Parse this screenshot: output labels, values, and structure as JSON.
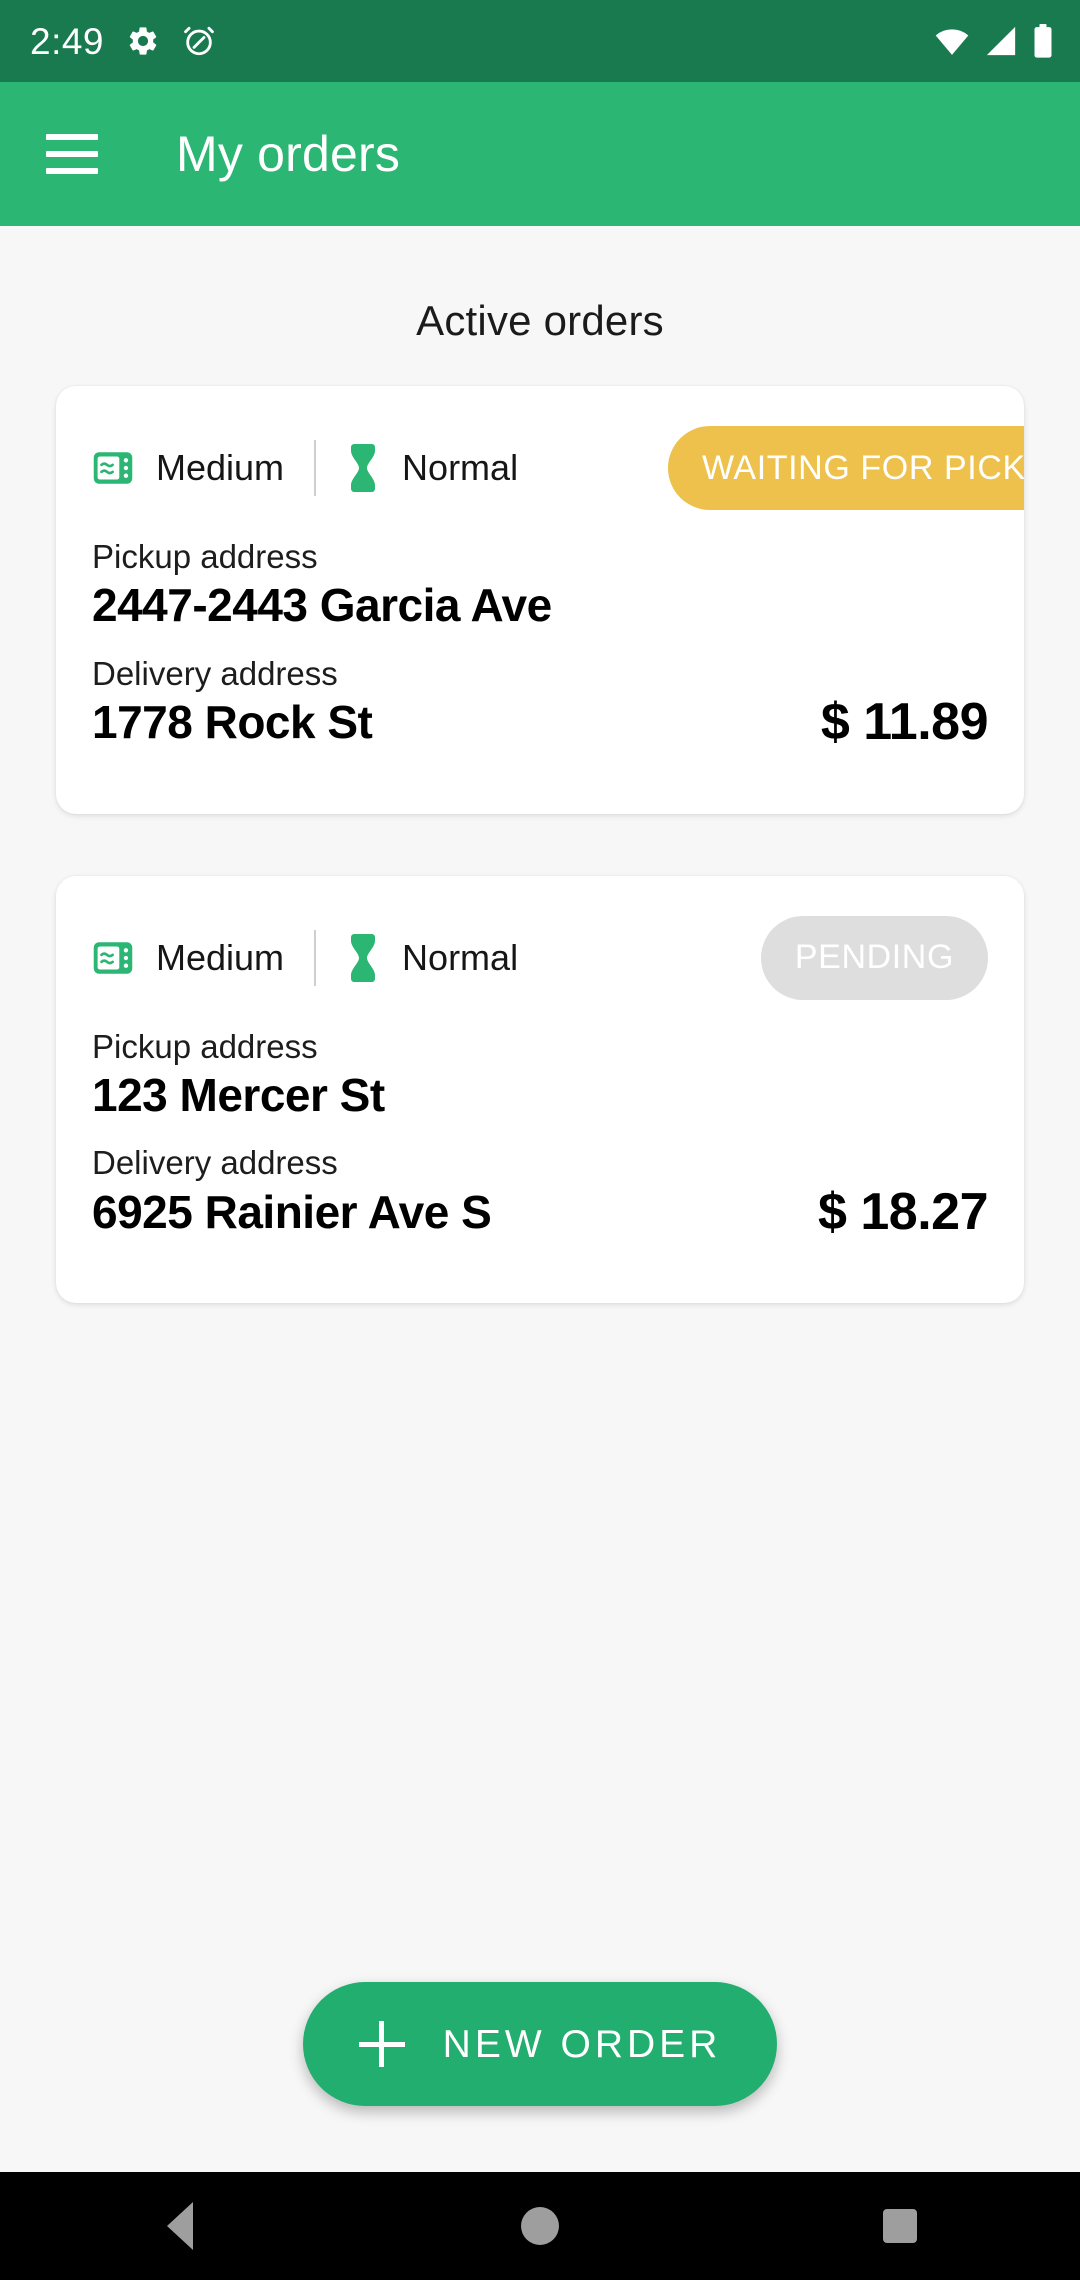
{
  "status_bar": {
    "time": "2:49",
    "icons_left": [
      "settings-gear-icon",
      "alarm-clock-icon"
    ],
    "icons_right": [
      "wifi-icon",
      "cellular-signal-icon",
      "battery-icon"
    ]
  },
  "app_bar": {
    "menu_icon": "hamburger-menu-icon",
    "title": "My orders"
  },
  "main": {
    "section_title": "Active orders",
    "labels": {
      "pickup": "Pickup address",
      "delivery": "Delivery address"
    },
    "orders": [
      {
        "size_icon": "package-size-icon",
        "size": "Medium",
        "speed_icon": "hourglass-icon",
        "speed": "Normal",
        "status": "WAITING FOR PICKUP",
        "status_style": "waiting",
        "status_color": "#edc14c",
        "pickup_address": "2447-2443 Garcia Ave",
        "delivery_address": "1778 Rock St",
        "price": "$ 11.89"
      },
      {
        "size_icon": "package-size-icon",
        "size": "Medium",
        "speed_icon": "hourglass-icon",
        "speed": "Normal",
        "status": "PENDING",
        "status_style": "pending",
        "status_color": "#dedede",
        "pickup_address": "123 Mercer St",
        "delivery_address": "6925 Rainier Ave S",
        "price": "$ 18.27"
      }
    ]
  },
  "fab": {
    "icon": "plus-icon",
    "label": "NEW ORDER",
    "color": "#21ae6f"
  },
  "nav_bar": {
    "back": "back-triangle-icon",
    "home": "home-circle-icon",
    "recents": "recents-square-icon"
  },
  "theme": {
    "status_bar_bg": "#1a7a4f",
    "app_bar_bg": "#2cb673",
    "page_bg": "#f7f7f7",
    "accent": "#2cb673"
  }
}
